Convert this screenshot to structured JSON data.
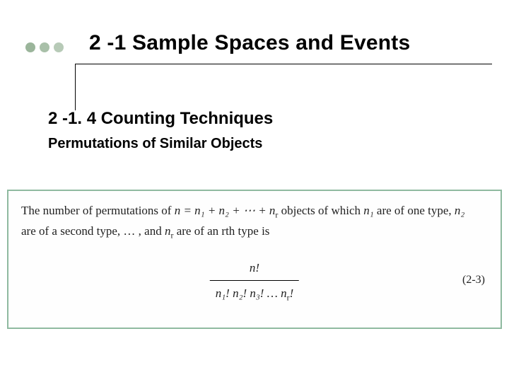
{
  "header": {
    "title": "2 -1 Sample Spaces and Events"
  },
  "section": {
    "subtitle": "2 -1. 4 Counting Techniques",
    "topic": "Permutations of Similar Objects"
  },
  "theorem": {
    "line1_pre": "The number of permutations of ",
    "line1_eq": "n = n₁ + n₂ + ⋯ + n",
    "line1_eq_sub": "r",
    "line1_mid": " objects of which ",
    "line1_n1": "n₁",
    "line1_post": " are of ",
    "line2_pre": "one type, ",
    "line2_n2": "n₂",
    "line2_mid": " are of a second type, … , and ",
    "line2_nr": "n",
    "line2_nr_sub": "r",
    "line2_post": " are of an rth type is",
    "frac_top": "n!",
    "frac_bot": "n₁! n₂! n₃! … n",
    "frac_bot_sub": "r",
    "frac_bot_end": "!",
    "eq_number": "(2-3)"
  }
}
